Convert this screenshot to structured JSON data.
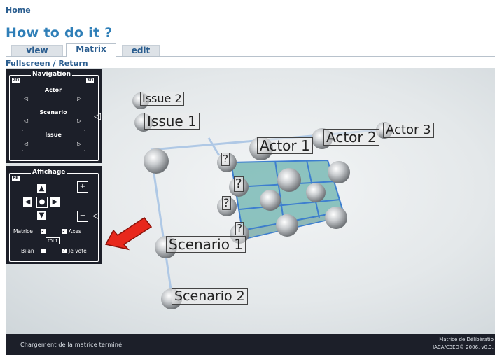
{
  "header": {
    "home": "Home",
    "title": "How to do it ?",
    "tabs": [
      {
        "label": "view"
      },
      {
        "label": "Matrix"
      },
      {
        "label": "edit"
      }
    ],
    "fullscreen": "Fullscreen",
    "separator": "/",
    "return": "Return"
  },
  "navigation": {
    "legend": "Navigation",
    "tag_2d": "2D",
    "tag_3d": "3D",
    "actor": "Actor",
    "scenario": "Scenario",
    "issue": "Issue"
  },
  "affichage": {
    "legend": "Affichage",
    "tag_fr": "FR",
    "matrice": "Matrice",
    "axes": "Axes",
    "tout": "tout",
    "bilan": "Bilan",
    "je_vote": "Je vote",
    "matrice_checked": true,
    "axes_checked": true,
    "bilan_checked": false,
    "je_vote_checked": true
  },
  "matrix": {
    "issues": [
      "Issue 2",
      "Issue 1"
    ],
    "actors": [
      "Actor 1",
      "Actor 2",
      "Actor 3"
    ],
    "scenarios": [
      "Scenario 1",
      "Scenario 2"
    ],
    "unknown_marker": "?"
  },
  "status": {
    "message": "Chargement de la matrice terminé.",
    "credit_line1": "Matrice de Délibératio",
    "credit_line2": "IACA/C3ED© 2006, v0.3."
  },
  "colors": {
    "link": "#2a5d8f",
    "title": "#2f7fb8",
    "panel": "#1c1f29",
    "cube": "#3a9a94",
    "axis": "#a9c4e4",
    "arrow": "#e8281c"
  }
}
